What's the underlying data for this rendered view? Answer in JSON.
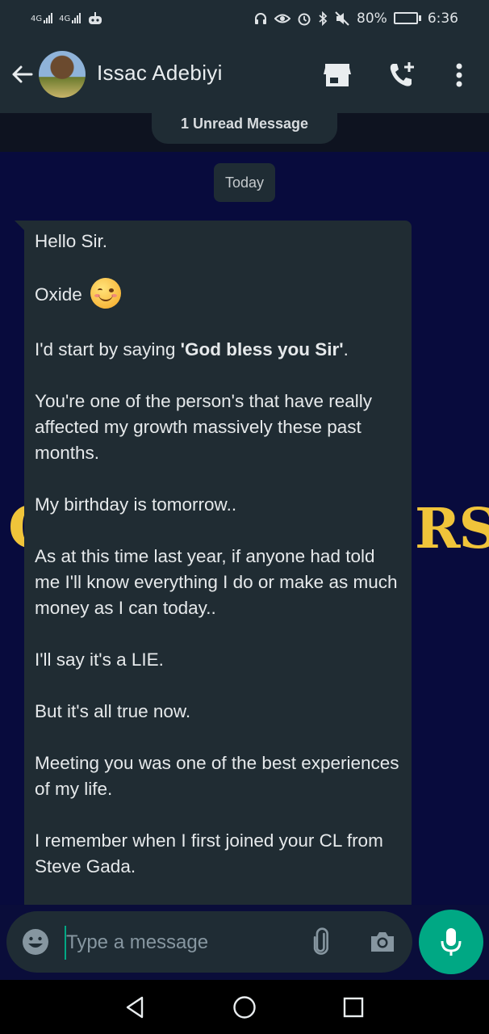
{
  "status_bar": {
    "network1": "4G",
    "network2": "4G",
    "battery_percent": "80%",
    "battery_level": 0.8,
    "time": "6:36"
  },
  "header": {
    "contact_name": "Issac Adebiyi",
    "icons": [
      "back-arrow-icon",
      "store-icon",
      "add-call-icon",
      "more-vert-icon"
    ]
  },
  "chat": {
    "unread_banner": "1 Unread Message",
    "date_label": "Today",
    "background_brand_left": "C",
    "background_brand_right": "RS",
    "message": {
      "p1": "Hello Sir.",
      "p2": "Oxide",
      "p2_emoji": "smiling-face-emoji",
      "p3_prefix": "I'd start by saying ",
      "p3_bold": "'God bless you Sir'",
      "p3_suffix": ".",
      "p4": "You're one of the person's that have really affected my growth massively these past months.",
      "p5": "My birthday is tomorrow..",
      "p6": "As at this time last year, if anyone had told me I'll know everything I do or make as much money as I can today..",
      "p7": "I'll say it's a LIE.",
      "p8": "But it's all true now.",
      "p9": "Meeting you was one of the best experiences of my life.",
      "p10": "I remember when I first joined your CL from Steve Gada."
    }
  },
  "composer": {
    "placeholder": "Type a message",
    "icons": [
      "emoji-icon",
      "attach-icon",
      "camera-icon",
      "mic-icon"
    ]
  },
  "colors": {
    "accent": "#00a884",
    "header_bg": "#1f2c34",
    "bubble_bg": "#202c33",
    "chat_bg": "#080b3d",
    "brand_gold": "#f0c43a"
  }
}
